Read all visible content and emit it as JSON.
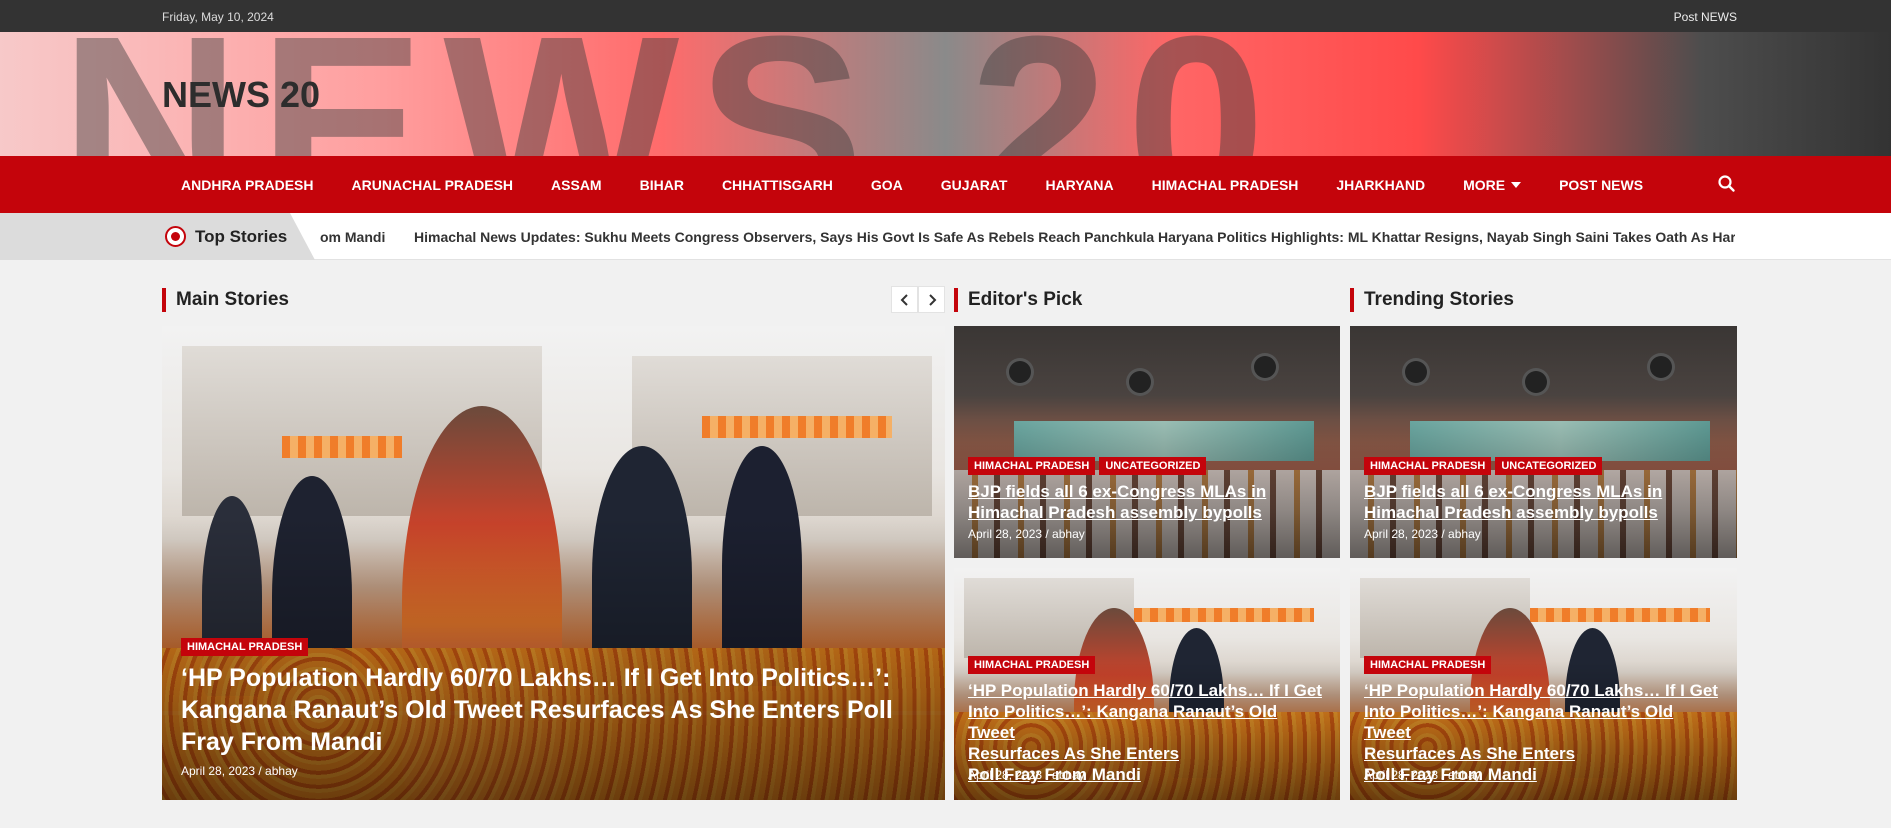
{
  "topbar": {
    "date": "Friday, May 10, 2024",
    "post_news": "Post NEWS"
  },
  "header": {
    "logo": "NEWS 20",
    "banner_text": "NEWS 20"
  },
  "nav": {
    "items": [
      "ANDHRA PRADESH",
      "ARUNACHAL PRADESH",
      "ASSAM",
      "BIHAR",
      "CHHATTISGARH",
      "GOA",
      "GUJARAT",
      "HARYANA",
      "HIMACHAL PRADESH",
      "JHARKHAND"
    ],
    "more_label": "MORE",
    "post_news_label": "POST NEWS",
    "search_icon": "search-icon"
  },
  "ticker": {
    "label": "Top Stories",
    "items": [
      "om Mandi",
      "Himachal News Updates: Sukhu Meets Congress Observers, Says His Govt Is Safe As Rebels Reach Panchkula",
      "Haryana Politics Highlights: ML Khattar Resigns, Nayab Singh Saini Takes Oath As Haryana"
    ]
  },
  "sections": {
    "main": "Main Stories",
    "editors": "Editor's Pick",
    "trending": "Trending Stories"
  },
  "main_story": {
    "category": "HIMACHAL PRADESH",
    "title": "‘HP Population Hardly 60/70 Lakhs… If I Get Into Politics…’: Kangana Ranaut’s Old Tweet Resurfaces As She Enters Poll Fray From Mandi",
    "meta": "April 28, 2023 / abhay"
  },
  "editors_pick": [
    {
      "categories": [
        "HIMACHAL PRADESH",
        "UNCATEGORIZED"
      ],
      "title_line1": "BJP fields all 6 ex-Congress MLAs in",
      "title_line2": "Himachal Pradesh assembly bypolls",
      "meta": "April 28, 2023 / abhay"
    },
    {
      "categories": [
        "HIMACHAL PRADESH"
      ],
      "title_line1": "‘HP Population Hardly 60/70 Lakhs… If I Get",
      "title_line2": "Into Politics…’: Kangana Ranaut’s Old Tweet",
      "title_line3": "Resurfaces As She Enters",
      "title_line4": "Poll Fray From Mandi",
      "meta": "April 28, 2023 / abhay"
    }
  ],
  "trending": [
    {
      "categories": [
        "HIMACHAL PRADESH",
        "UNCATEGORIZED"
      ],
      "title_line1": "BJP fields all 6 ex-Congress MLAs in",
      "title_line2": "Himachal Pradesh assembly bypolls",
      "meta": "April 28, 2023 / abhay"
    },
    {
      "categories": [
        "HIMACHAL PRADESH"
      ],
      "title_line1": "‘HP Population Hardly 60/70 Lakhs… If I Get",
      "title_line2": "Into Politics…’: Kangana Ranaut’s Old Tweet",
      "title_line3": "Resurfaces As She Enters",
      "title_line4": "Poll Fray From Mandi",
      "meta": "April 28, 2023 / abhay"
    }
  ],
  "colors": {
    "brand_red": "#c4040b",
    "topbar": "#333333",
    "page_bg": "#f1f1f1"
  }
}
